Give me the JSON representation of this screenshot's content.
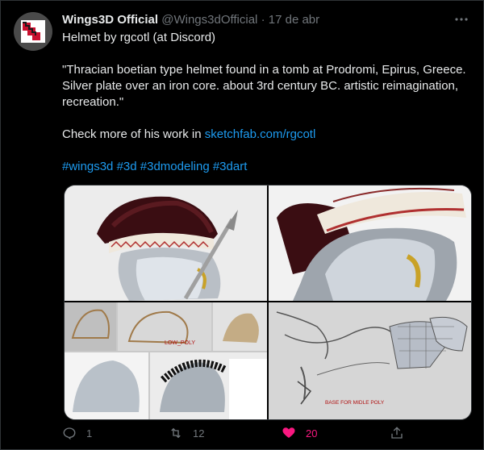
{
  "tweet": {
    "display_name": "Wings3D Official",
    "handle": "@Wings3dOfficial",
    "separator": "·",
    "date": "17 de abr",
    "line1": "Helmet by rgcotl (at Discord)",
    "quote": "\"Thracian boetian type helmet found in a tomb at Prodromi, Epirus, Greece. Silver plate over an iron core. about 3rd century BC. artistic reimagination, recreation.\"",
    "check_prefix": "Check more of his work in ",
    "check_link": "sketchfab.com/rgcotl",
    "hashtags": [
      "#wings3d",
      "#3d",
      "#3dmodeling",
      "#3dart"
    ]
  },
  "media": {
    "label_low_poly": "LOW_POLY",
    "label_base": "BASE FOR MIDLE POLY"
  },
  "actions": {
    "reply_count": "1",
    "retweet_count": "12",
    "like_count": "20"
  },
  "colors": {
    "link": "#1d9bf0",
    "like": "#f91880",
    "muted": "#71767b"
  }
}
